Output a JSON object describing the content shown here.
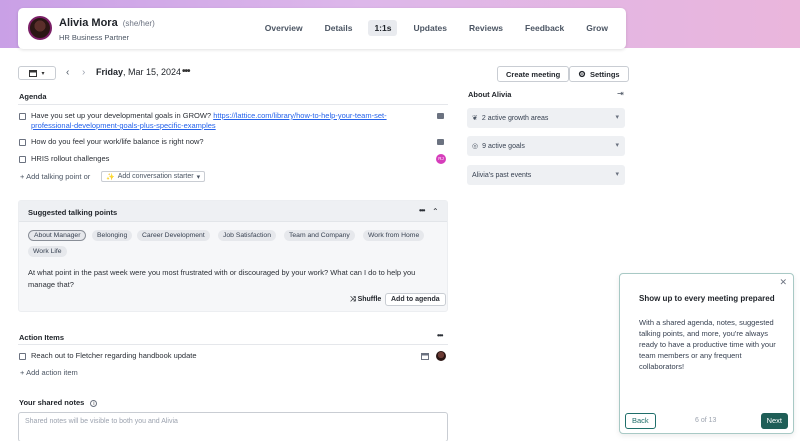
{
  "header": {
    "name": "Alivia Mora",
    "pronouns": "(she/her)",
    "title": "HR Business Partner",
    "nav": [
      "Overview",
      "Details",
      "1:1s",
      "Updates",
      "Reviews",
      "Feedback",
      "Grow"
    ],
    "active_nav": "1:1s"
  },
  "toolbar": {
    "calendar_icon": "calendar-icon",
    "prev": "‹",
    "next": "›",
    "date_weekday": "Friday",
    "date_rest": ", Mar 15, 2024",
    "more": "•••",
    "create_meeting": "Create meeting",
    "settings": "Settings"
  },
  "agenda": {
    "title": "Agenda",
    "items": [
      {
        "text": "Have you set up your developmental goals in GROW? ",
        "link": "https://lattice.com/library/how-to-help-your-team-set-professional-development-goals-plus-specific-examples"
      },
      {
        "text": "How do you feel your work/life balance is right now?"
      },
      {
        "text": "HRIS rollout challenges",
        "badge": "RJ"
      }
    ],
    "add_point": "Add talking point or",
    "add_starter": "Add conversation starter"
  },
  "suggested": {
    "title": "Suggested talking points",
    "more": "•••",
    "collapse": "⌃",
    "chips": [
      "About Manager",
      "Belonging",
      "Career Development",
      "Job Satisfaction",
      "Team and Company",
      "Work from Home",
      "Work Life"
    ],
    "question": "At what point in the past week were you most frustrated with or discouraged by your work? What can I do to help you manage that?",
    "shuffle": "Shuffle",
    "add_to_agenda": "Add to agenda"
  },
  "action_items": {
    "title": "Action Items",
    "more": "•••",
    "items": [
      {
        "text": "Reach out to Fletcher regarding handbook update"
      }
    ],
    "add": "Add action item"
  },
  "notes": {
    "title": "Your shared notes",
    "placeholder": "Shared notes will be visible to both you and Alivia"
  },
  "about": {
    "title": "About Alivia",
    "sections": [
      "2 active growth areas",
      "9 active goals",
      "Alivia's past events"
    ]
  },
  "popover": {
    "title": "Show up to every meeting prepared",
    "body": "With a shared agenda, notes, suggested talking points, and more, you're always ready to have a productive time with your team members or any frequent collaborators!",
    "back": "Back",
    "step": "6 of 13",
    "next": "Next"
  },
  "colors": {
    "accent": "#1f5e57",
    "link": "#2563eb",
    "gradient_start": "#c9a0e6",
    "gradient_end": "#eab6dc",
    "badge": "#d63dbb"
  }
}
